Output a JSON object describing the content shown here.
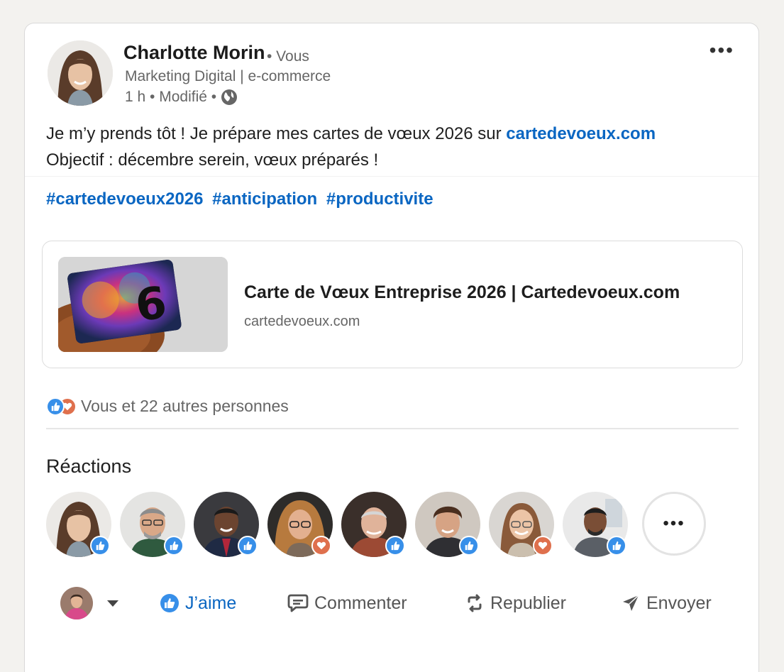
{
  "author": {
    "name": "Charlotte Morin",
    "relation": "• Vous",
    "headline": "Marketing Digital | e-commerce",
    "meta": "1 h • Modifié •",
    "visibility_icon": "globe-icon"
  },
  "post": {
    "text_before_link": "Je m’y prends tôt ! Je prépare mes cartes de vœux 2026 sur ",
    "link_text": "cartedevoeux.com",
    "second_line": "Objectif : décembre serein, vœux préparés !",
    "hashtags": [
      "#cartedevoeux2026",
      "#anticipation",
      "#productivite"
    ]
  },
  "link_preview": {
    "title": "Carte de Vœux Entreprise 2026 | Cartedevoeux.com",
    "domain": "cartedevoeux.com",
    "thumb_text": "6"
  },
  "reactions": {
    "summary": "Vous et 22 autres personnes",
    "heading": "Réactions",
    "reactors": [
      {
        "reaction": "like"
      },
      {
        "reaction": "like"
      },
      {
        "reaction": "like"
      },
      {
        "reaction": "love"
      },
      {
        "reaction": "like"
      },
      {
        "reaction": "like"
      },
      {
        "reaction": "love"
      },
      {
        "reaction": "like"
      }
    ],
    "more_label": "•••"
  },
  "actions": {
    "like": "J’aime",
    "comment": "Commenter",
    "repost": "Republier",
    "send": "Envoyer"
  },
  "colors": {
    "link_blue": "#0a66c2",
    "like_blue": "#378fe9",
    "love_orange": "#df704d",
    "page_bg": "#f3f2ef"
  }
}
